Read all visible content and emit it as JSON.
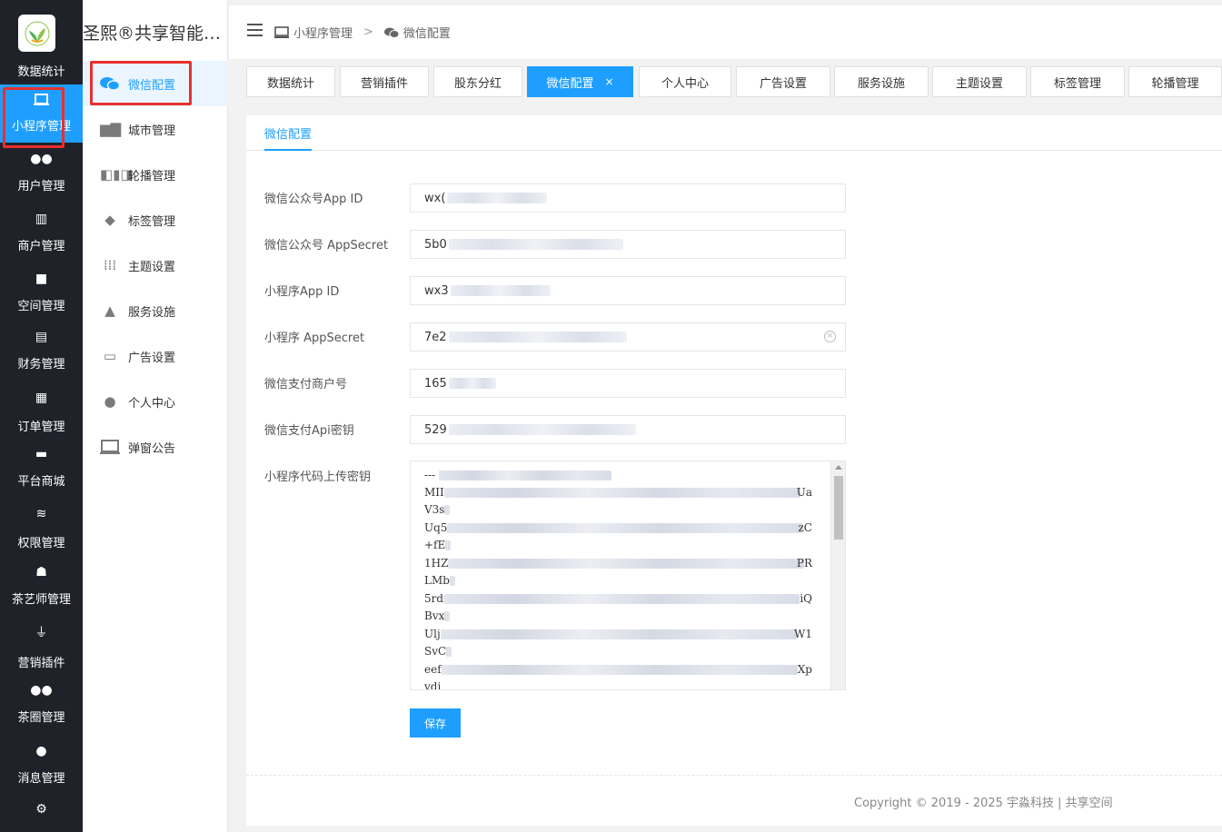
{
  "rail": {
    "top_label": "数据统计",
    "items": [
      {
        "label": "小程序管理",
        "icon": "monitor-icon"
      },
      {
        "label": "用户管理",
        "icon": "users-icon"
      },
      {
        "label": "商户管理",
        "icon": "building-icon"
      },
      {
        "label": "空间管理",
        "icon": "cube-icon"
      },
      {
        "label": "财务管理",
        "icon": "list-icon"
      },
      {
        "label": "订单管理",
        "icon": "clipboard-icon"
      },
      {
        "label": "平台商城",
        "icon": "store-icon"
      },
      {
        "label": "权限管理",
        "icon": "database-icon"
      },
      {
        "label": "茶艺师管理",
        "icon": "user-settings-icon"
      },
      {
        "label": "营销插件",
        "icon": "plug-icon"
      },
      {
        "label": "茶圈管理",
        "icon": "group-icon"
      },
      {
        "label": "消息管理",
        "icon": "chat-icon"
      }
    ]
  },
  "sub": {
    "title": "圣熙®共享智能空间",
    "items": [
      {
        "label": "微信配置",
        "icon": "wechat-icon"
      },
      {
        "label": "城市管理",
        "icon": "city-icon"
      },
      {
        "label": "轮播管理",
        "icon": "carousel-icon"
      },
      {
        "label": "标签管理",
        "icon": "tag-icon"
      },
      {
        "label": "主题设置",
        "icon": "grid-icon"
      },
      {
        "label": "服务设施",
        "icon": "tree-icon"
      },
      {
        "label": "广告设置",
        "icon": "card-icon"
      },
      {
        "label": "个人中心",
        "icon": "person-icon"
      },
      {
        "label": "弹窗公告",
        "icon": "laptop-icon"
      }
    ]
  },
  "breadcrumb": {
    "first": "小程序管理",
    "separator": ">",
    "second": "微信配置"
  },
  "tabs": [
    {
      "label": "数据统计"
    },
    {
      "label": "营销插件"
    },
    {
      "label": "股东分红"
    },
    {
      "label": "微信配置",
      "close": "×"
    },
    {
      "label": "个人中心"
    },
    {
      "label": "广告设置"
    },
    {
      "label": "服务设施"
    },
    {
      "label": "主题设置"
    },
    {
      "label": "标签管理"
    },
    {
      "label": "轮播管理"
    }
  ],
  "inner_tab": "微信配置",
  "form": {
    "fields": [
      {
        "label": "微信公众号App ID",
        "value": "wx("
      },
      {
        "label": "微信公众号 AppSecret",
        "value": "5b0"
      },
      {
        "label": "小程序App ID",
        "value": "wx3"
      },
      {
        "label": "小程序 AppSecret",
        "value": "7e2"
      },
      {
        "label": "微信支付商户号",
        "value": "165"
      },
      {
        "label": "微信支付Api密钥",
        "value": "529"
      }
    ],
    "key_label": "小程序代码上传密钥",
    "key_lines": [
      {
        "start": "---",
        "end": ""
      },
      {
        "start": "MII",
        "end": "Ua"
      },
      {
        "start": "V3s",
        "end": ""
      },
      {
        "start": "Uq5",
        "end": "zC"
      },
      {
        "start": "+fE",
        "end": ""
      },
      {
        "start": "1HZ",
        "end": "PR"
      },
      {
        "start": "LMb",
        "end": ""
      },
      {
        "start": "5rd",
        "end": "iQ"
      },
      {
        "start": "Bvx",
        "end": ""
      },
      {
        "start": "Ulj",
        "end": "W1"
      },
      {
        "start": "SvC",
        "end": ""
      },
      {
        "start": "eef",
        "end": "Xp"
      },
      {
        "start": "vdj",
        "end": ""
      }
    ],
    "save_label": "保存"
  },
  "footer": {
    "copyright": "Copyright © 2019 - 2025 宇淼科技 | 共享空间"
  },
  "colors": {
    "accent": "#1e9fff",
    "rail_bg": "#20222a",
    "highlight_box": "#e8302f"
  }
}
